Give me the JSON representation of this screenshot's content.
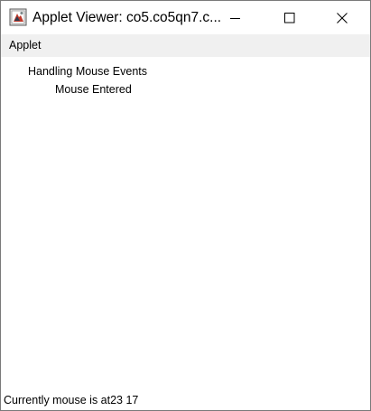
{
  "window": {
    "title": "Applet Viewer: co5.co5qn7.c...",
    "icon": "java-applet-icon"
  },
  "titlebar_controls": {
    "minimize_icon": "minimize-icon",
    "maximize_icon": "maximize-icon",
    "close_icon": "close-icon"
  },
  "menubar": {
    "items": [
      {
        "label": "Applet"
      }
    ]
  },
  "applet": {
    "heading": "Handling Mouse Events",
    "event_message": "Mouse Entered"
  },
  "status": {
    "text": "Currently mouse is at23 17"
  },
  "colors": {
    "menubar_bg": "#f0f0f0",
    "window_bg": "#ffffff",
    "border": "#7a7a7a"
  }
}
